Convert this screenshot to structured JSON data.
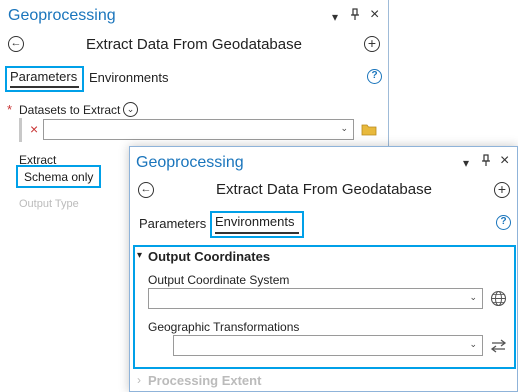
{
  "back_pane": {
    "title": "Geoprocessing",
    "tool_title": "Extract Data From Geodatabase",
    "tabs": {
      "parameters": "Parameters",
      "environments": "Environments"
    },
    "datasets_label": "Datasets to Extract",
    "required_marker": "*",
    "remove_glyph": "×",
    "extract_label": "Extract",
    "extract_value": "Schema only",
    "output_type_label": "Output Type"
  },
  "front_pane": {
    "title": "Geoprocessing",
    "tool_title": "Extract Data From Geodatabase",
    "tabs": {
      "parameters": "Parameters",
      "environments": "Environments"
    },
    "section_output": "Output Coordinates",
    "coord_system_label": "Output Coordinate System",
    "coord_system_value": "",
    "geo_trans_label": "Geographic Transformations",
    "geo_trans_value": "",
    "section_processing": "Processing Extent"
  },
  "icons": {
    "titlebar_dropdown": "▾",
    "titlebar_pin": "pin-icon",
    "titlebar_close": "×",
    "back": "←",
    "add": "+",
    "help": "?",
    "chevron": "⌄",
    "section_expanded": "▾",
    "section_collapsed": "›"
  },
  "colors": {
    "accent": "#00a0e8",
    "title_blue": "#1a75bc",
    "required_red": "#c83232",
    "folder": "#e8b93c"
  }
}
